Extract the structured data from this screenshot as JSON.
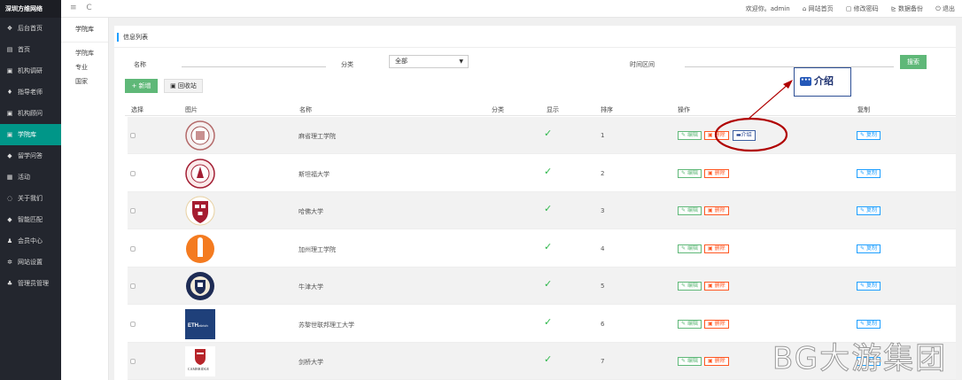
{
  "sidebar": {
    "brand": "深圳方维网络",
    "items": [
      {
        "icon": "home-icon",
        "glyph": "❖",
        "label": "后台首页"
      },
      {
        "icon": "page-icon",
        "glyph": "▤",
        "label": "首页"
      },
      {
        "icon": "briefcase-icon",
        "glyph": "▣",
        "label": "机构调研"
      },
      {
        "icon": "pin-icon",
        "glyph": "♦",
        "label": "指导老师"
      },
      {
        "icon": "lock-icon",
        "glyph": "▣",
        "label": "机构顾问"
      },
      {
        "icon": "folder-icon",
        "glyph": "▣",
        "label": "学院库",
        "active": true
      },
      {
        "icon": "tag-icon",
        "glyph": "◆",
        "label": "留学问答"
      },
      {
        "icon": "calendar-icon",
        "glyph": "▦",
        "label": "活动"
      },
      {
        "icon": "chat-icon",
        "glyph": "◌",
        "label": "关于我们"
      },
      {
        "icon": "tag-icon",
        "glyph": "◆",
        "label": "智能匹配"
      },
      {
        "icon": "user-icon",
        "glyph": "♟",
        "label": "会员中心"
      },
      {
        "icon": "gear-icon",
        "glyph": "✲",
        "label": "网站设置"
      },
      {
        "icon": "users-icon",
        "glyph": "♣",
        "label": "管理员管理"
      }
    ]
  },
  "topbar": {
    "tools": [
      "≡",
      "C"
    ],
    "welcome": "欢迎你。admin",
    "links": [
      "网站首页",
      "修改密码",
      "数据备份",
      "退出"
    ]
  },
  "submenu": {
    "title": "学院库",
    "items": [
      "学院库",
      "专业",
      "国家"
    ]
  },
  "panel": {
    "title": "信息列表",
    "filters": {
      "name_label": "名称",
      "category_label": "分类",
      "category_value": "全部",
      "time_label": "时间区间",
      "search_label": "搜索"
    },
    "add_label": "+ 新增",
    "recycle_label": "回收站",
    "columns": [
      "选择",
      "图片",
      "名称",
      "分类",
      "显示",
      "排序",
      "操作",
      "复制"
    ],
    "edit_label": "编辑",
    "delete_label": "删除",
    "copy_label": "复制",
    "intro_label": "介绍",
    "rows": [
      {
        "name": "麻省理工学院",
        "sort": "1",
        "logo": "mit-seal"
      },
      {
        "name": "斯坦福大学",
        "sort": "2",
        "logo": "stanford-seal"
      },
      {
        "name": "哈佛大学",
        "sort": "3",
        "logo": "harvard-seal"
      },
      {
        "name": "加州理工学院",
        "sort": "4",
        "logo": "caltech-seal"
      },
      {
        "name": "牛津大学",
        "sort": "5",
        "logo": "oxford-seal"
      },
      {
        "name": "苏黎世联邦理工大学",
        "sort": "6",
        "logo": "eth-logo"
      },
      {
        "name": "剑桥大学",
        "sort": "7",
        "logo": "cambridge-logo"
      }
    ]
  },
  "callout": {
    "label": "介绍"
  },
  "watermark": "BG大游集团",
  "colors": {
    "sidebar": "#23262e",
    "active": "#009688",
    "green": "#5fb878",
    "red": "#ff5722",
    "blue": "#1e9fff",
    "annotation": "#b00000"
  }
}
